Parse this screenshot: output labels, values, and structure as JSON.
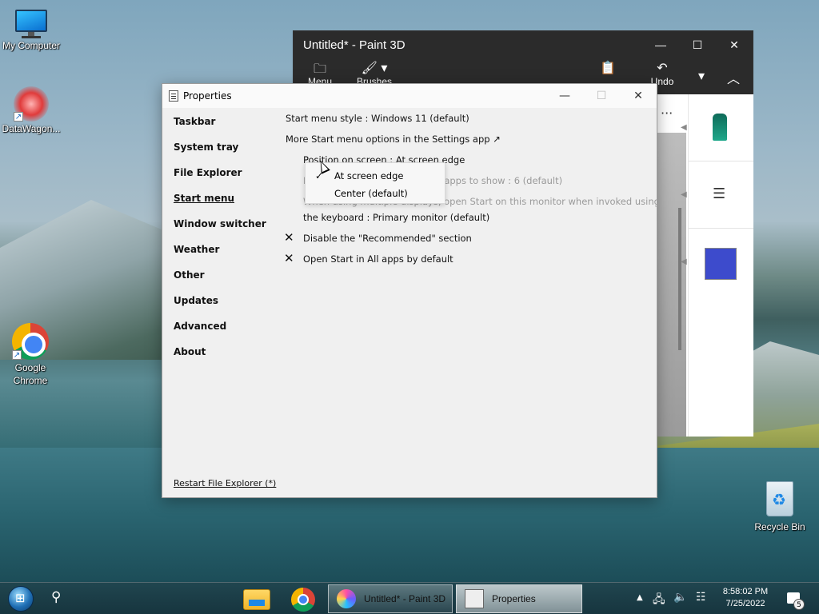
{
  "desktop": {
    "icons": [
      {
        "label": "My Computer"
      },
      {
        "label": "DataWagon..."
      },
      {
        "label": "Google Chrome"
      },
      {
        "label": "Recycle Bin"
      }
    ]
  },
  "paint3d": {
    "title": "Untitled* - Paint 3D",
    "toolbar": {
      "menu_label": "Menu",
      "brushes_label": "Brushes",
      "undo_label": "Undo"
    },
    "accent_swatch": "#3d4bcc"
  },
  "properties": {
    "title": "Properties",
    "nav": [
      {
        "label": "Taskbar"
      },
      {
        "label": "System tray"
      },
      {
        "label": "File Explorer"
      },
      {
        "label": "Start menu"
      },
      {
        "label": "Window switcher"
      },
      {
        "label": "Weather"
      },
      {
        "label": "Other"
      },
      {
        "label": "Updates"
      },
      {
        "label": "Advanced"
      },
      {
        "label": "About"
      }
    ],
    "active_nav": "Start menu",
    "restart_link": "Restart File Explorer (*)",
    "settings": {
      "start_menu_style": "Start menu style : Windows 11 (default)",
      "more_options": "More Start menu options in the Settings app ↗",
      "position": "Position on screen : At screen edge",
      "max_frequent": "Maximum number of frequent apps to show : 6 (default)",
      "multi_display_line1": "When using multiple displays, open Start on this monitor when invoked using",
      "multi_display_line2": "the keyboard : Primary monitor (default)",
      "disable_recommended": "Disable the \"Recommended\" section",
      "open_all_apps": "Open Start in All apps by default"
    },
    "dropdown": {
      "options": [
        "At screen edge",
        "Center (default)"
      ],
      "selected": "At screen edge"
    }
  },
  "taskbar": {
    "tasks": [
      {
        "label": "Untitled* - Paint 3D"
      },
      {
        "label": "Properties"
      }
    ],
    "clock_time": "8:58:02 PM",
    "clock_date": "7/25/2022",
    "notification_count": "5"
  }
}
